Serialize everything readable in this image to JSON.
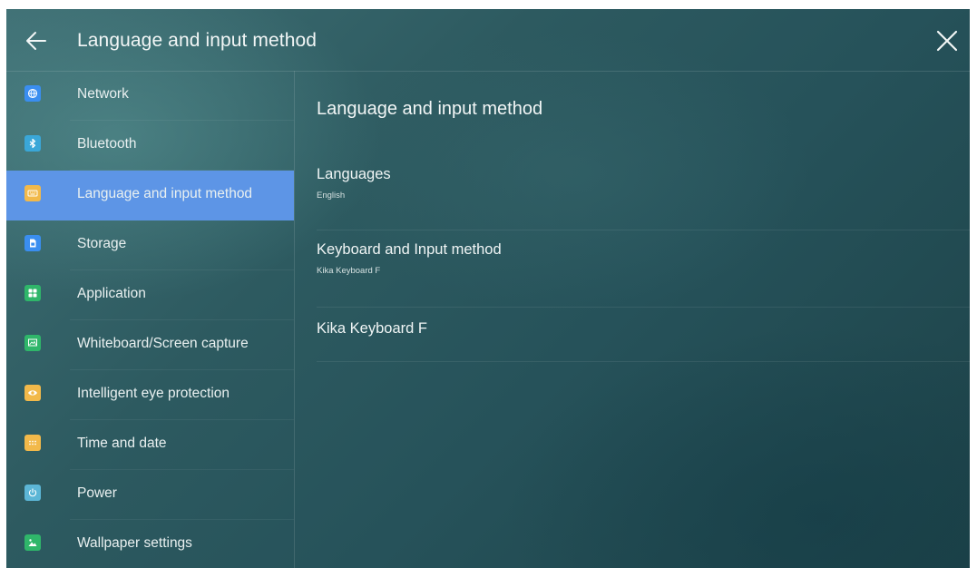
{
  "header": {
    "title": "Language and input method"
  },
  "sidebar": {
    "items": [
      {
        "label": "Network",
        "icon": "globe-icon",
        "color": "#3a8ef0",
        "active": false
      },
      {
        "label": "Bluetooth",
        "icon": "bluetooth-icon",
        "color": "#3aa7d8",
        "active": false
      },
      {
        "label": "Language and input method",
        "icon": "keyboard-icon",
        "color": "#f2b94a",
        "active": true
      },
      {
        "label": "Storage",
        "icon": "storage-icon",
        "color": "#3a8ef0",
        "active": false
      },
      {
        "label": "Application",
        "icon": "apps-icon",
        "color": "#2fb66a",
        "active": false
      },
      {
        "label": "Whiteboard/Screen capture",
        "icon": "whiteboard-icon",
        "color": "#2fb66a",
        "active": false
      },
      {
        "label": "Intelligent eye protection",
        "icon": "eye-icon",
        "color": "#f2b94a",
        "active": false
      },
      {
        "label": "Time and date",
        "icon": "clock-grid-icon",
        "color": "#f2b94a",
        "active": false
      },
      {
        "label": "Power",
        "icon": "power-icon",
        "color": "#5cb6d6",
        "active": false
      },
      {
        "label": "Wallpaper settings",
        "icon": "image-icon",
        "color": "#2fb66a",
        "active": false
      }
    ]
  },
  "content": {
    "title": "Language and input method",
    "settings": [
      {
        "title": "Languages",
        "subtitle": "English"
      },
      {
        "title": "Keyboard and Input method",
        "subtitle": "Kika Keyboard F"
      },
      {
        "title": "Kika Keyboard F",
        "subtitle": ""
      }
    ]
  },
  "colors": {
    "active_item": "#5d95e6",
    "text": "#f0f5f5"
  }
}
